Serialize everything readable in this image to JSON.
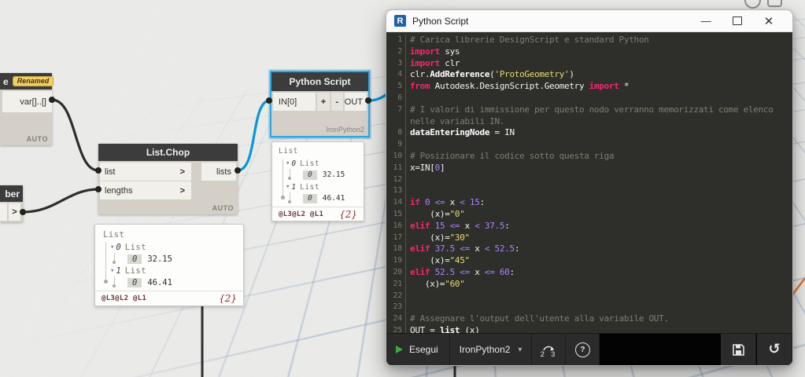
{
  "palette": {
    "accent_blue": "#0A96D6",
    "wire_dark": "#2E2E2E",
    "wire_orange": "#E8772E",
    "selection_blue": "#2FA7E0",
    "node_header": "#3C3C3C",
    "node_body": "#D4D0C8",
    "keyword_pink": "#F92672",
    "number_purple": "#AE81FF",
    "string_yellow": "#E6DB74",
    "comment_gray": "#7F7F72"
  },
  "icons": {
    "collapse_triangle": "▾",
    "caret_down": "▾",
    "play": "run-triangle",
    "revert": "↺",
    "help": "?",
    "minimize": "—",
    "close": "✕"
  },
  "canvas": {
    "renamed_node": {
      "title_fragment": "e",
      "badge": "Renamed",
      "output_port": "var[]..[]",
      "footer": "AUTO"
    },
    "number_node": {
      "title_fragment": "ber",
      "output_port": ">"
    },
    "list_chop": {
      "title": "List.Chop",
      "inputs": [
        "list",
        "lengths"
      ],
      "chevron": ">",
      "output": "lists",
      "footer": "AUTO"
    },
    "python_node": {
      "title": "Python Script",
      "input": "IN[0]",
      "add_label": "+",
      "remove_label": "-",
      "output": "OUT",
      "engine": "IronPython2"
    }
  },
  "watch": {
    "tree": {
      "root": "List",
      "branches": [
        {
          "index": "0",
          "label": "List",
          "items": [
            {
              "index": "0",
              "value": "32.15"
            }
          ]
        },
        {
          "index": "1",
          "label": "List",
          "items": [
            {
              "index": "0",
              "value": "46.41"
            }
          ]
        }
      ]
    },
    "footer_levels": "@L3@L2 @L1",
    "footer_count": "{2}"
  },
  "window": {
    "title": "Python Script",
    "app_icon_letter": "R",
    "controls": {
      "minimize": "—",
      "close": "✕"
    }
  },
  "toolbar": {
    "run_label": "Esegui",
    "engine_label": "IronPython2",
    "migrate_label": "2 3",
    "help_label": "?",
    "revert_glyph": "↺"
  },
  "editor": {
    "lines": [
      {
        "n": "1",
        "t": [
          [
            "c",
            "# Carica librerie DesignScript e standard Python"
          ]
        ]
      },
      {
        "n": "2",
        "t": [
          [
            "k",
            "import"
          ],
          [
            "p",
            " sys"
          ]
        ]
      },
      {
        "n": "3",
        "t": [
          [
            "k",
            "import"
          ],
          [
            "p",
            " clr"
          ]
        ]
      },
      {
        "n": "4",
        "t": [
          [
            "p",
            "clr."
          ],
          [
            "b",
            "AddReference"
          ],
          [
            "p",
            "("
          ],
          [
            "s",
            "'ProtoGeometry'"
          ],
          [
            "p",
            ")"
          ]
        ]
      },
      {
        "n": "5",
        "t": [
          [
            "k",
            "from"
          ],
          [
            "p",
            " Autodesk.DesignScript.Geometry "
          ],
          [
            "k",
            "import"
          ],
          [
            "p",
            " *"
          ]
        ]
      },
      {
        "n": "6",
        "t": []
      },
      {
        "n": "7",
        "t": [
          [
            "c",
            "# I valori di immissione per questo nodo verranno memorizzati come elenco"
          ]
        ]
      },
      {
        "n": "",
        "t": [
          [
            "c",
            "nelle variabili IN."
          ]
        ]
      },
      {
        "n": "8",
        "t": [
          [
            "b",
            "dataEnteringNode"
          ],
          [
            "p",
            " = IN"
          ]
        ]
      },
      {
        "n": "9",
        "t": []
      },
      {
        "n": "10",
        "t": [
          [
            "c",
            "# Posizionare il codice sotto questa riga"
          ]
        ]
      },
      {
        "n": "11",
        "t": [
          [
            "p",
            "x=IN["
          ],
          [
            "n2",
            "0"
          ],
          [
            "p",
            "]"
          ]
        ]
      },
      {
        "n": "12",
        "t": []
      },
      {
        "n": "13",
        "t": []
      },
      {
        "n": "14",
        "t": [
          [
            "k",
            "if"
          ],
          [
            "p",
            " "
          ],
          [
            "n2",
            "0"
          ],
          [
            "p",
            " "
          ],
          [
            "o",
            "<="
          ],
          [
            "p",
            " x "
          ],
          [
            "o",
            "<"
          ],
          [
            "p",
            " "
          ],
          [
            "n2",
            "15"
          ],
          [
            "p",
            ":"
          ]
        ]
      },
      {
        "n": "15",
        "t": [
          [
            "p",
            "    (x)="
          ],
          [
            "s",
            "\"0\""
          ]
        ]
      },
      {
        "n": "16",
        "t": [
          [
            "k",
            "elif"
          ],
          [
            "p",
            " "
          ],
          [
            "n2",
            "15"
          ],
          [
            "p",
            " "
          ],
          [
            "o",
            "<="
          ],
          [
            "p",
            " x "
          ],
          [
            "o",
            "<"
          ],
          [
            "p",
            " "
          ],
          [
            "n2",
            "37.5"
          ],
          [
            "p",
            ":"
          ]
        ]
      },
      {
        "n": "17",
        "t": [
          [
            "p",
            "    (x)="
          ],
          [
            "s",
            "\"30\""
          ]
        ]
      },
      {
        "n": "18",
        "t": [
          [
            "k",
            "elif"
          ],
          [
            "p",
            " "
          ],
          [
            "n2",
            "37.5"
          ],
          [
            "p",
            " "
          ],
          [
            "o",
            "<="
          ],
          [
            "p",
            " x "
          ],
          [
            "o",
            "<"
          ],
          [
            "p",
            " "
          ],
          [
            "n2",
            "52.5"
          ],
          [
            "p",
            ":"
          ]
        ]
      },
      {
        "n": "19",
        "t": [
          [
            "p",
            "    (x)="
          ],
          [
            "s",
            "\"45\""
          ]
        ]
      },
      {
        "n": "20",
        "t": [
          [
            "k",
            "elif"
          ],
          [
            "p",
            " "
          ],
          [
            "n2",
            "52.5"
          ],
          [
            "p",
            " "
          ],
          [
            "o",
            "<="
          ],
          [
            "p",
            " x "
          ],
          [
            "o",
            "<="
          ],
          [
            "p",
            " "
          ],
          [
            "n2",
            "60"
          ],
          [
            "p",
            ":"
          ]
        ]
      },
      {
        "n": "21",
        "t": [
          [
            "p",
            "   (x)="
          ],
          [
            "s",
            "\"60\""
          ]
        ]
      },
      {
        "n": "22",
        "t": []
      },
      {
        "n": "23",
        "t": []
      },
      {
        "n": "24",
        "t": [
          [
            "c",
            "# Assegnare l'output dell'utente alla variabile OUT."
          ]
        ]
      },
      {
        "n": "25",
        "t": [
          [
            "p",
            "OUT = "
          ],
          [
            "b",
            "list"
          ],
          [
            "p",
            " (x)"
          ]
        ]
      }
    ]
  }
}
